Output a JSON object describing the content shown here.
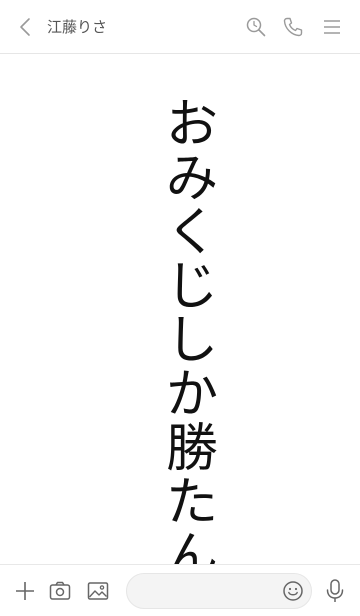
{
  "header": {
    "title": "江藤りさ",
    "icons": {
      "back": "chevron-left-icon",
      "search": "search-clock-icon",
      "call": "phone-icon",
      "menu": "menu-icon"
    }
  },
  "message": {
    "chars": [
      "お",
      "み",
      "く",
      "じ",
      "し",
      "か",
      "勝",
      "た",
      "ん"
    ]
  },
  "footer": {
    "input_placeholder": "",
    "icons": {
      "add": "plus-icon",
      "camera": "camera-icon",
      "image": "image-icon",
      "emoji": "emoji-icon",
      "mic": "microphone-icon"
    }
  },
  "colors": {
    "icon": "#9a9a9a",
    "text": "#111111",
    "header_title": "#555555"
  }
}
